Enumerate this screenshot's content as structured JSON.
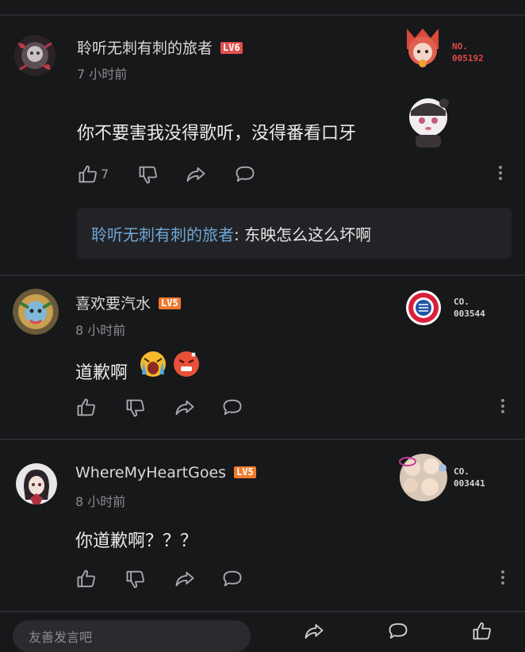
{
  "comments": [
    {
      "username": "聆听无刺有刺的旅者",
      "level": "LV6",
      "time": "7 小时前",
      "content": "你不要害我没得歌听，没得番看口牙",
      "likes": "7",
      "badge_label": "NO.",
      "badge_number": "005192",
      "reply": {
        "name": "聆听无刺有刺的旅者",
        "text": ": 东映怎么这么坏啊"
      }
    },
    {
      "username": "喜欢要汽水",
      "level": "LV5",
      "time": "8 小时前",
      "content": "道歉啊",
      "badge_label": "CO.",
      "badge_number": "003544"
    },
    {
      "username": "WhereMyHeartGoes",
      "level": "LV5",
      "time": "8 小时前",
      "content": "你道歉啊？？？",
      "badge_label": "CO.",
      "badge_number": "003441"
    }
  ],
  "footer": {
    "reply_placeholder": "友善发言吧"
  },
  "colors": {
    "background": "#17181a",
    "level6": "#e2504e",
    "level5": "#f07a2d",
    "reply_name": "#6ea7d6",
    "badge_red": "#e04848"
  }
}
